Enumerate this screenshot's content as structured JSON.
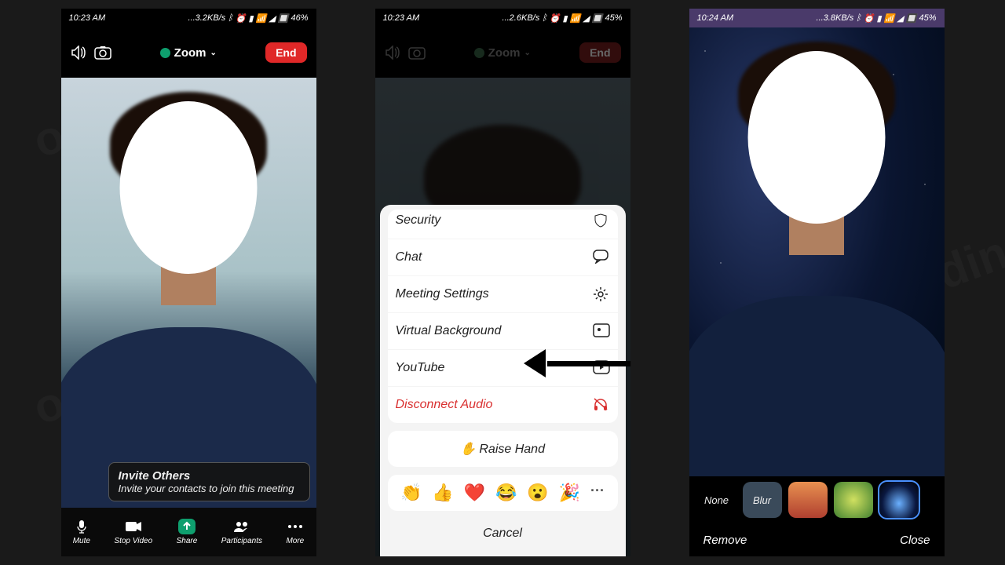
{
  "screens": {
    "s1": {
      "time": "10:23 AM",
      "net": "...3.2KB/s",
      "batt": "46%",
      "app": "Zoom",
      "end": "End",
      "invite_title": "Invite Others",
      "invite_sub": "Invite your contacts to join this meeting",
      "bottom": [
        "Mute",
        "Stop Video",
        "Share",
        "Participants",
        "More"
      ]
    },
    "s2": {
      "time": "10:23 AM",
      "net": "...2.6KB/s",
      "batt": "45%",
      "app": "Zoom",
      "end": "End",
      "menu": {
        "security": "Security",
        "chat": "Chat",
        "settings": "Meeting Settings",
        "vbg": "Virtual Background",
        "youtube": "YouTube",
        "disconnect": "Disconnect Audio"
      },
      "raise": "Raise Hand",
      "emojis": [
        "👏",
        "👍",
        "❤️",
        "😂",
        "😮",
        "🎉",
        "···"
      ],
      "cancel": "Cancel"
    },
    "s3": {
      "time": "10:24 AM",
      "net": "...3.8KB/s",
      "batt": "45%",
      "options": {
        "none": "None",
        "blur": "Blur"
      },
      "remove": "Remove",
      "close": "Close"
    }
  }
}
